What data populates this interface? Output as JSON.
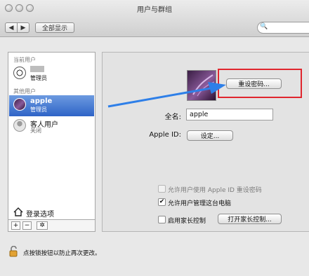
{
  "window": {
    "title": "用户与群组",
    "nav_back_glyph": "◀",
    "nav_forward_glyph": "▶",
    "show_all_label": "全部显示",
    "search_glyph": "🔍"
  },
  "sidebar": {
    "current_user_section": "当前用户",
    "current_user": {
      "name": "",
      "role": "管理员"
    },
    "other_users_section": "其他用户",
    "users": [
      {
        "name": "apple",
        "role": "管理员"
      },
      {
        "name": "客人用户",
        "role": "关闭"
      }
    ],
    "login_options_label": "登录选项",
    "add_glyph": "+",
    "remove_glyph": "−",
    "settings_glyph": "✲"
  },
  "detail": {
    "reset_password_label": "重设密码...",
    "full_name_label": "全名:",
    "full_name_value": "apple",
    "apple_id_label": "Apple ID:",
    "apple_id_button": "设定...",
    "options": [
      {
        "label": "允许用户使用 Apple ID 重设密码",
        "checked": false,
        "enabled": false
      },
      {
        "label": "允许用户管理这台电脑",
        "checked": true,
        "enabled": true
      },
      {
        "label": "启用家长控制",
        "checked": false,
        "enabled": true
      }
    ],
    "parental_button": "打开家长控制...",
    "check_glyph": "✔"
  },
  "footer": {
    "lock_text": "点按锁按钮以防止再次更改。"
  },
  "colors": {
    "highlight": "#e0262e",
    "selection": "#2f64c7",
    "arrow": "#2e7fe8"
  }
}
